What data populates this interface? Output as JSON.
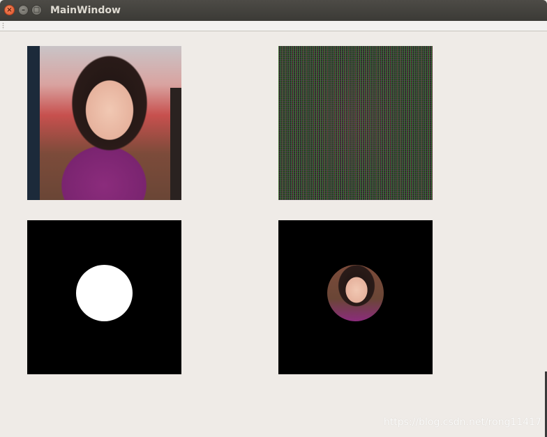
{
  "window": {
    "title": "MainWindow",
    "close_glyph": "×",
    "minimize_glyph": "–",
    "maximize_glyph": "□"
  },
  "panels": {
    "original": {
      "icon": "photo-image"
    },
    "scrambled": {
      "icon": "noise-image"
    },
    "mask": {
      "icon": "circle-mask-image"
    },
    "result": {
      "icon": "masked-result-image"
    }
  },
  "watermark": "https://blog.csdn.net/rong11417",
  "colors": {
    "window_bg": "#efebe7",
    "titlebar": "#3b3a36",
    "close_button": "#e0522a",
    "mask_bg": "#000000",
    "mask_circle": "#ffffff"
  }
}
